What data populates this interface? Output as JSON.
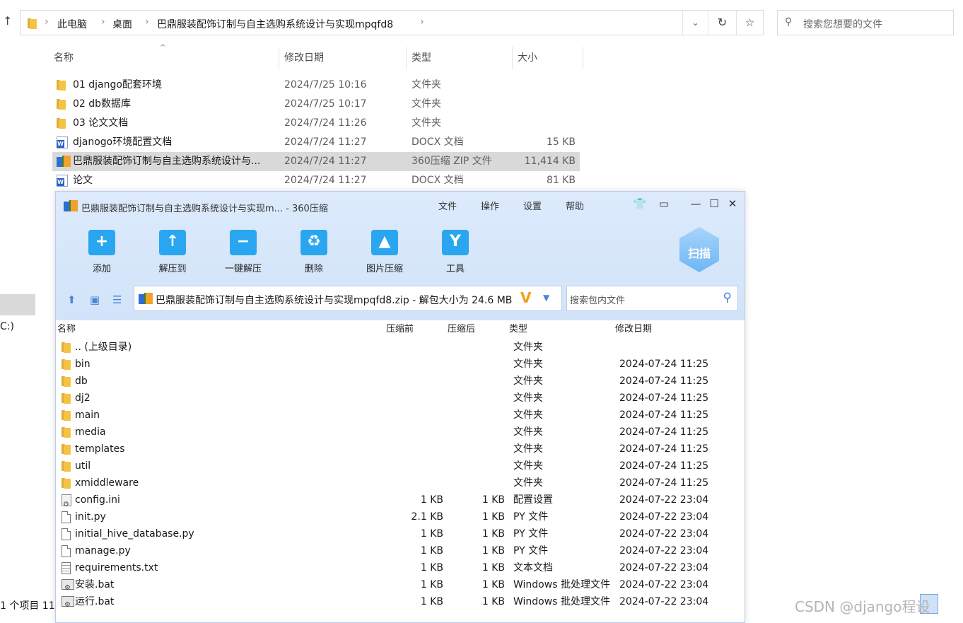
{
  "explorer": {
    "breadcrumbs": [
      "此电脑",
      "桌面",
      "巴鼎服装配饰订制与自主选购系统设计与实现mpqfd8"
    ],
    "search_placeholder": "搜索您想要的文件",
    "columns": {
      "name": "名称",
      "date": "修改日期",
      "type": "类型",
      "size": "大小"
    },
    "files": [
      {
        "name": "01 django配套环境",
        "date": "2024/7/25 10:16",
        "type": "文件夹",
        "size": "",
        "icon": "folder-icon"
      },
      {
        "name": "02 db数据库",
        "date": "2024/7/25 10:17",
        "type": "文件夹",
        "size": "",
        "icon": "folder-icon"
      },
      {
        "name": "03 论文文档",
        "date": "2024/7/24 11:26",
        "type": "文件夹",
        "size": "",
        "icon": "folder-icon"
      },
      {
        "name": "djanogo环境配置文档",
        "date": "2024/7/24 11:27",
        "type": "DOCX 文档",
        "size": "15 KB",
        "icon": "word-icon"
      },
      {
        "name": "巴鼎服装配饰订制与自主选购系统设计与...",
        "date": "2024/7/24 11:27",
        "type": "360压缩 ZIP 文件",
        "size": "11,414 KB",
        "icon": "zip-icon"
      },
      {
        "name": "论文",
        "date": "2024/7/24 11:27",
        "type": "DOCX 文档",
        "size": "81 KB",
        "icon": "word-icon"
      }
    ],
    "sidebar_drive_label": "C:)",
    "status": "1 个项目  11"
  },
  "zip_window": {
    "title": "巴鼎服装配饰订制与自主选购系统设计与实现m... - 360压缩",
    "menu": [
      "文件",
      "操作",
      "设置",
      "帮助"
    ],
    "tools": [
      "添加",
      "解压到",
      "一键解压",
      "删除",
      "图片压缩",
      "工具"
    ],
    "scan_label": "扫描",
    "path": "巴鼎服装配饰订制与自主选购系统设计与实现mpqfd8.zip - 解包大小为 24.6 MB",
    "search_placeholder": "搜索包内文件",
    "columns": {
      "name": "名称",
      "packed": "压缩前",
      "compressed": "压缩后",
      "type": "类型",
      "date": "修改日期"
    },
    "entries": [
      {
        "name": ".. (上级目录)",
        "p1": "",
        "p2": "",
        "type": "文件夹",
        "date": "",
        "icon": "folder-icon"
      },
      {
        "name": "bin",
        "p1": "",
        "p2": "",
        "type": "文件夹",
        "date": "2024-07-24 11:25",
        "icon": "folder-icon"
      },
      {
        "name": "db",
        "p1": "",
        "p2": "",
        "type": "文件夹",
        "date": "2024-07-24 11:25",
        "icon": "folder-icon"
      },
      {
        "name": "dj2",
        "p1": "",
        "p2": "",
        "type": "文件夹",
        "date": "2024-07-24 11:25",
        "icon": "folder-icon"
      },
      {
        "name": "main",
        "p1": "",
        "p2": "",
        "type": "文件夹",
        "date": "2024-07-24 11:25",
        "icon": "folder-icon"
      },
      {
        "name": "media",
        "p1": "",
        "p2": "",
        "type": "文件夹",
        "date": "2024-07-24 11:25",
        "icon": "folder-icon"
      },
      {
        "name": "templates",
        "p1": "",
        "p2": "",
        "type": "文件夹",
        "date": "2024-07-24 11:25",
        "icon": "folder-icon"
      },
      {
        "name": "util",
        "p1": "",
        "p2": "",
        "type": "文件夹",
        "date": "2024-07-24 11:25",
        "icon": "folder-icon"
      },
      {
        "name": "xmiddleware",
        "p1": "",
        "p2": "",
        "type": "文件夹",
        "date": "2024-07-24 11:25",
        "icon": "folder-icon"
      },
      {
        "name": "config.ini",
        "p1": "1 KB",
        "p2": "1 KB",
        "type": "配置设置",
        "date": "2024-07-22 23:04",
        "icon": "config-file-icon"
      },
      {
        "name": "init.py",
        "p1": "2.1 KB",
        "p2": "1 KB",
        "type": "PY 文件",
        "date": "2024-07-22 23:04",
        "icon": "file-icon"
      },
      {
        "name": "initial_hive_database.py",
        "p1": "1 KB",
        "p2": "1 KB",
        "type": "PY 文件",
        "date": "2024-07-22 23:04",
        "icon": "file-icon"
      },
      {
        "name": "manage.py",
        "p1": "1 KB",
        "p2": "1 KB",
        "type": "PY 文件",
        "date": "2024-07-22 23:04",
        "icon": "file-icon"
      },
      {
        "name": "requirements.txt",
        "p1": "1 KB",
        "p2": "1 KB",
        "type": "文本文档",
        "date": "2024-07-22 23:04",
        "icon": "text-file-icon"
      },
      {
        "name": "安装.bat",
        "p1": "1 KB",
        "p2": "1 KB",
        "type": "Windows 批处理文件",
        "date": "2024-07-22 23:04",
        "icon": "batch-file-icon"
      },
      {
        "name": "运行.bat",
        "p1": "1 KB",
        "p2": "1 KB",
        "type": "Windows 批处理文件",
        "date": "2024-07-22 23:04",
        "icon": "batch-file-icon"
      }
    ]
  },
  "watermark": "CSDN @django程设"
}
